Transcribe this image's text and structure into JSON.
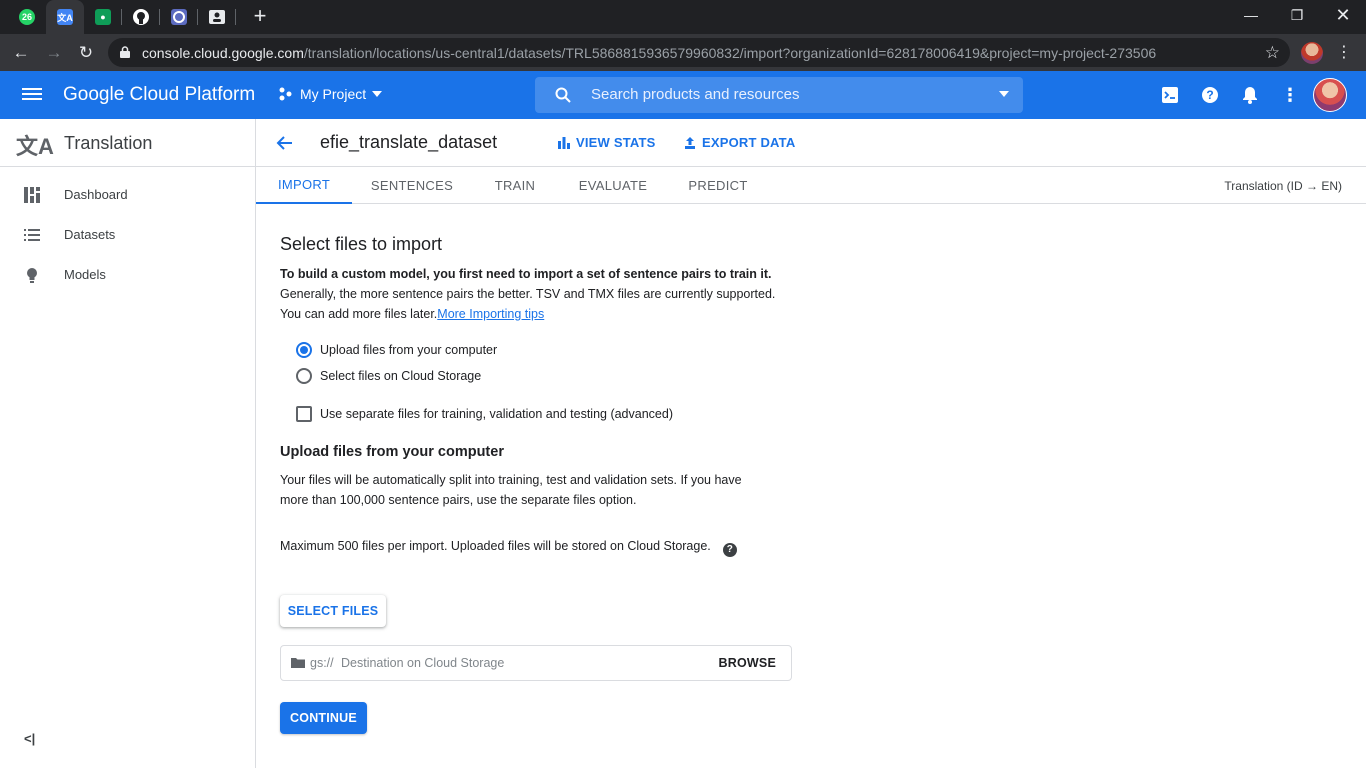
{
  "browser": {
    "tabs": [
      {
        "icon": "whatsapp-icon",
        "badge": "26",
        "color": "#25d366"
      },
      {
        "icon": "translate-icon",
        "color": "#4285f4",
        "active": true
      },
      {
        "icon": "classroom-icon",
        "color": "#0f9d58"
      },
      {
        "icon": "github-icon",
        "color": "#ffffff"
      },
      {
        "icon": "app-icon",
        "color": "#8ab4f8"
      },
      {
        "icon": "contact-card-icon",
        "color": "#e8eaed"
      }
    ],
    "url_host": "console.cloud.google.com",
    "url_path": "/translation/locations/us-central1/datasets/TRL5868815936579960832/import?organizationId=628178006419&project=my-project-273506"
  },
  "header": {
    "brand": "Google Cloud Platform",
    "project": "My Project",
    "search_placeholder": "Search products and resources",
    "accent": "#1a73e8"
  },
  "sidebar": {
    "product": "Translation",
    "items": [
      {
        "label": "Dashboard",
        "icon": "dashboard-icon"
      },
      {
        "label": "Datasets",
        "icon": "list-icon"
      },
      {
        "label": "Models",
        "icon": "lightbulb-icon"
      }
    ],
    "collapse": "<|"
  },
  "main": {
    "dataset_name": "efie_translate_dataset",
    "view_stats": "VIEW STATS",
    "export_data": "EXPORT DATA",
    "tabs": [
      "IMPORT",
      "SENTENCES",
      "TRAIN",
      "EVALUATE",
      "PREDICT"
    ],
    "active_tab": "IMPORT",
    "lang_pair": "Translation (ID → EN)",
    "section_title": "Select files to import",
    "intro_bold": "To build a custom model, you first need to import a set of sentence pairs to train it.",
    "intro_line2": "Generally, the more sentence pairs the better. TSV and TMX files are currently supported.",
    "intro_line3": "You can add more files later.",
    "intro_link": "More Importing tips",
    "radio_upload": "Upload files from your computer",
    "radio_storage": "Select files on Cloud Storage",
    "checkbox_separate": "Use separate files for training, validation and testing (advanced)",
    "upload_title": "Upload files from your computer",
    "upload_desc_1": "Your files will be automatically split into training, test and validation sets. If you have",
    "upload_desc_2": "more than 100,000 sentence pairs, use the separate files option.",
    "max_note": "Maximum 500 files per import. Uploaded files will be stored on Cloud Storage.",
    "select_files": "SELECT FILES",
    "dest_prefix": "gs://",
    "dest_placeholder": "Destination on Cloud Storage",
    "browse": "BROWSE",
    "continue": "CONTINUE"
  }
}
